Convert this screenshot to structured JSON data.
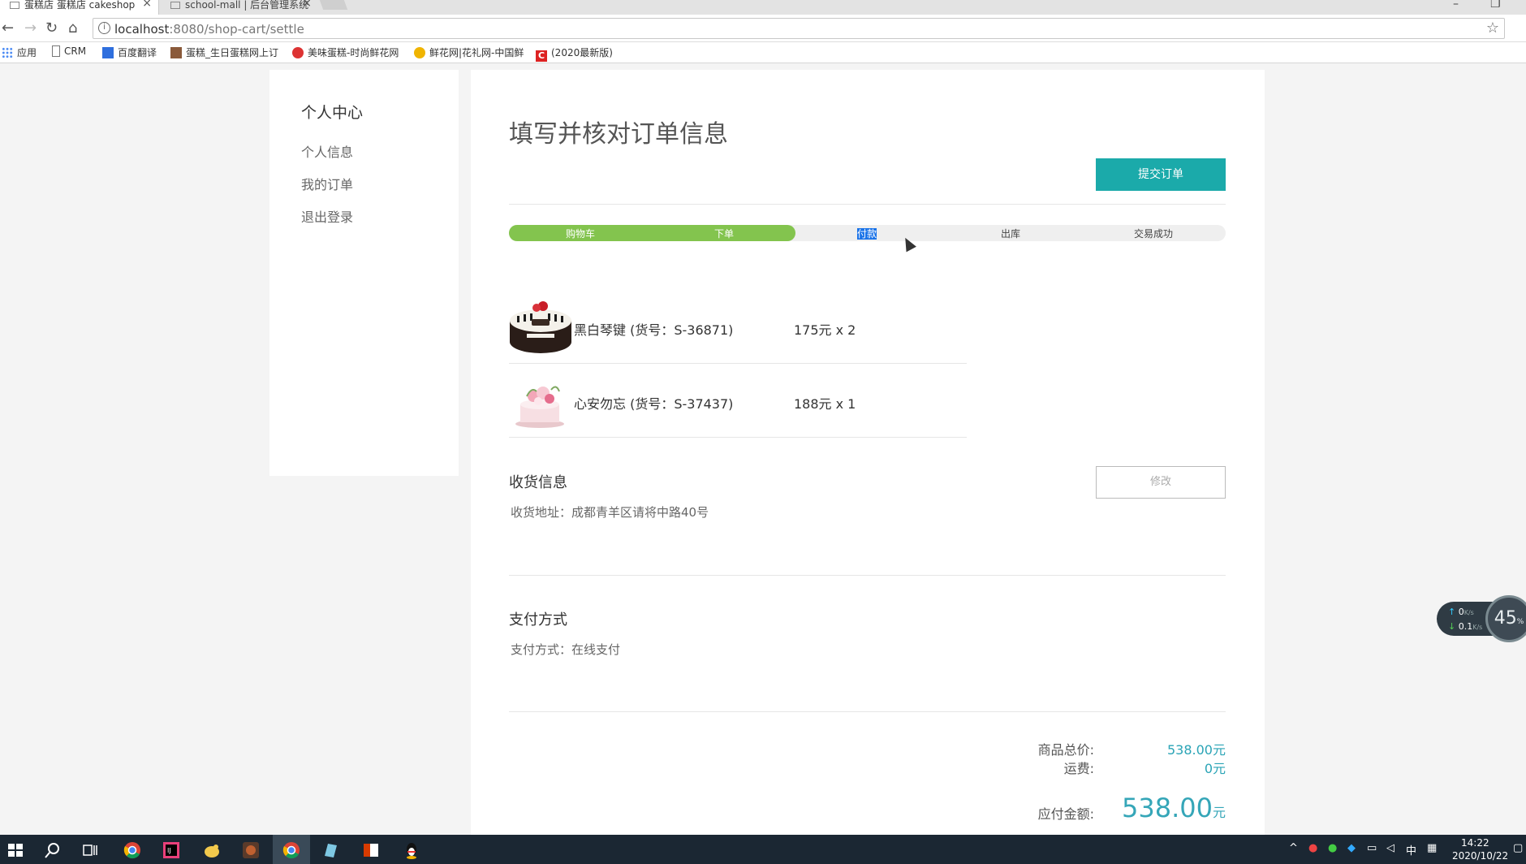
{
  "browser": {
    "tabs": [
      {
        "title": "蛋糕店 蛋糕店 cakeshop"
      },
      {
        "title": "school-mall | 后台管理系统"
      }
    ],
    "url_host": "localhost",
    "url_path": ":8080/shop-cart/settle",
    "bookmarks": [
      "应用",
      "CRM",
      "百度翻译",
      "蛋糕_生日蛋糕网上订",
      "美味蛋糕-时尚鲜花网",
      "鲜花网|花礼网-中国鲜",
      "(2020最新版)"
    ]
  },
  "sidebar": {
    "title": "个人中心",
    "links": [
      "个人信息",
      "我的订单",
      "退出登录"
    ]
  },
  "main": {
    "title": "填写并核对订单信息",
    "submit_label": "提交订单",
    "steps": [
      "购物车",
      "下单",
      "付款",
      "出库",
      "交易成功"
    ],
    "progress_fraction": 0.4,
    "items": [
      {
        "name": "黑白琴键 (货号：S-36871)",
        "price": "175元 x 2"
      },
      {
        "name": "心安勿忘 (货号：S-37437)",
        "price": "188元 x 1"
      }
    ],
    "shipping": {
      "title": "收货信息",
      "label": "收货地址：",
      "value": "成都青羊区请将中路40号",
      "modify_label": "修改"
    },
    "payment": {
      "title": "支付方式",
      "label": "支付方式：",
      "value": "在线支付"
    },
    "summary": {
      "subtotal_label": "商品总价:",
      "subtotal_value": "538.00元",
      "shipping_label": "运费:",
      "shipping_value": "0元",
      "total_label": "应付金额:",
      "total_value": "538.00",
      "total_unit": "元"
    }
  },
  "speed_widget": {
    "up": "0",
    "up_unit": "K/s",
    "down": "0.1",
    "down_unit": "K/s",
    "percent": "45",
    "percent_unit": "%"
  },
  "taskbar": {
    "ime": "中",
    "time": "14:22",
    "date": "2020/10/22"
  },
  "colors": {
    "accent": "#1baaaa",
    "progress": "#83c44e",
    "price": "#2aa4b6"
  }
}
